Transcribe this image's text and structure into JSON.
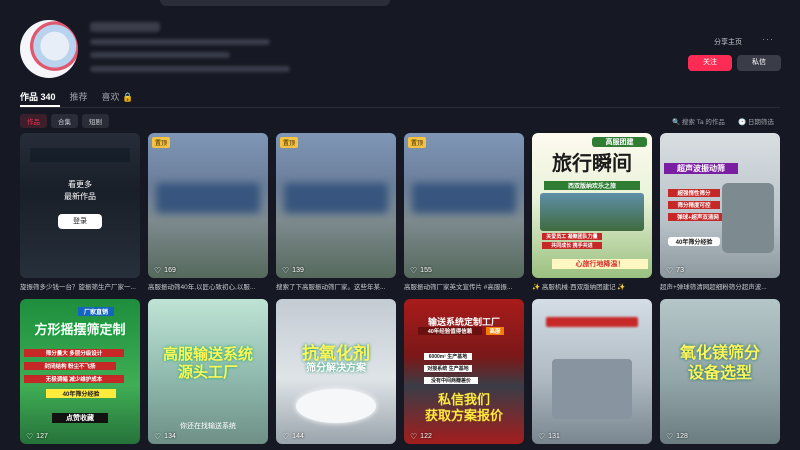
{
  "profile": {
    "share_label": "分享主页",
    "more_icon": "more-dots-icon",
    "follow_label": "关注",
    "message_label": "私信"
  },
  "tabs": [
    {
      "label": "作品 340",
      "active": true
    },
    {
      "label": "推荐",
      "active": false
    },
    {
      "label": "喜欢 🔒",
      "active": false
    }
  ],
  "chips": [
    {
      "label": "作品",
      "active": true
    },
    {
      "label": "合集",
      "active": false
    },
    {
      "label": "短剧",
      "active": false
    }
  ],
  "search_hint": "🔍 搜索 Ta 的作品",
  "date_filter": "🕒 日期筛选",
  "login_prompt": {
    "line1": "看更多",
    "line2": "最新作品",
    "button": "登录"
  },
  "cards": [
    {
      "caption": "旋振筛多少钱一台？旋振筛生产厂家一...",
      "likes": "",
      "pinned": false,
      "overlay": []
    },
    {
      "caption": "高服振动筛40年,以匠心致初心,以服...",
      "likes": "169",
      "pinned": true,
      "overlay": []
    },
    {
      "caption": "搜索了下高服振动筛厂家。这些年某...",
      "likes": "139",
      "pinned": true,
      "overlay": []
    },
    {
      "caption": "高服振动筛厂家英文宣传片 #高服振...",
      "likes": "155",
      "pinned": true,
      "overlay": []
    },
    {
      "caption": "✨ 高服机械·西双版纳团建记 ✨",
      "likes": "",
      "pinned": false,
      "overlay": [
        "高服团建",
        "旅行瞬间",
        "西双版纳欢乐之旅",
        "关爱员工 凝聚团队力量",
        "共同成长 携手共进",
        "心旅行地降温！"
      ]
    },
    {
      "caption": "超声+弹球筛清网超细粉筛分超声波...",
      "likes": "73",
      "pinned": false,
      "overlay": [
        "超声波振动筛",
        "超强惰性筛分",
        "筛分精度可控",
        "弹球+超声双清网",
        "40年筛分经验"
      ]
    },
    {
      "caption": "",
      "likes": "127",
      "pinned": false,
      "overlay": [
        "厂家直销",
        "方形摇摆筛定制",
        "筛分量大 多层分级设计",
        "封闭结构 粉尘不飞扬",
        "无极调幅 减少维护成本",
        "40年筛分经验",
        "点赞收藏"
      ]
    },
    {
      "caption": "",
      "likes": "134",
      "pinned": false,
      "overlay": [
        "高服输送系统",
        "源头工厂",
        "你还在找输送系统"
      ]
    },
    {
      "caption": "",
      "likes": "144",
      "pinned": false,
      "overlay": [
        "抗氧化剂",
        "筛分解决方案"
      ]
    },
    {
      "caption": "",
      "likes": "122",
      "pinned": false,
      "overlay": [
        "输送系统定制工厂",
        "40年经验值得信赖",
        "高服",
        "6000m² 生产基地",
        "对接系统 生产基地",
        "没有中间商赚差价",
        "私信我们",
        "获取方案报价"
      ]
    },
    {
      "caption": "",
      "likes": "131",
      "pinned": false,
      "overlay": []
    },
    {
      "caption": "",
      "likes": "128",
      "pinned": false,
      "overlay": [
        "氧化镁筛分",
        "设备选型"
      ]
    }
  ],
  "badge_text": "置顶"
}
